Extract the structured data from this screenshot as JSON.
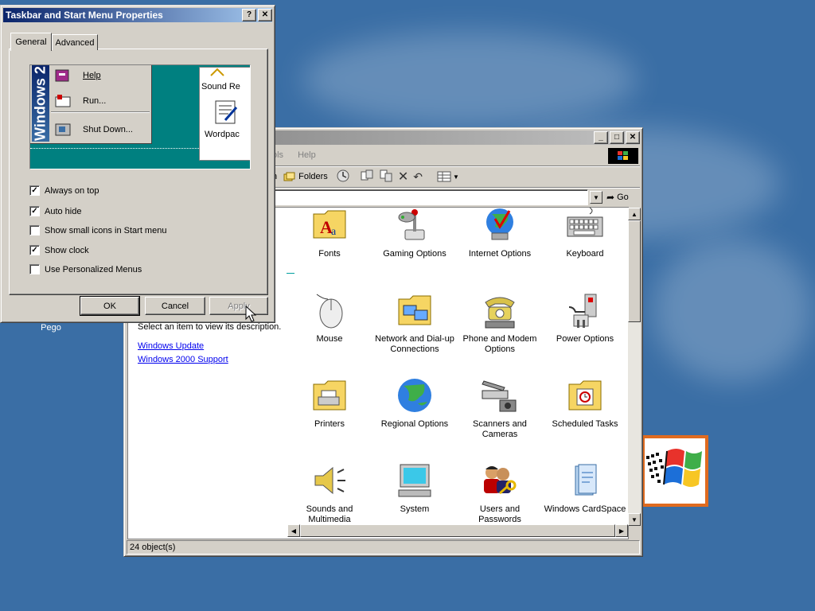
{
  "desktop": {
    "icon_label": "Pego"
  },
  "control_panel": {
    "menu_tools_partial": "ols",
    "menu_help": "Help",
    "toolbar_partial": "n",
    "toolbar_folders": "Folders",
    "go_label": "Go",
    "description_hint": "Select an item to view its description.",
    "links": [
      "Windows Update",
      "Windows 2000 Support"
    ],
    "items": [
      {
        "label": "Fonts",
        "icon": "fonts-icon"
      },
      {
        "label": "Gaming Options",
        "icon": "gamepad-icon"
      },
      {
        "label": "Internet Options",
        "icon": "globe-icon"
      },
      {
        "label": "Keyboard",
        "icon": "keyboard-icon"
      },
      {
        "label": "Mouse",
        "icon": "mouse-icon"
      },
      {
        "label": "Network and Dial-up Connections",
        "icon": "network-icon"
      },
      {
        "label": "Phone and Modem Options",
        "icon": "phone-icon"
      },
      {
        "label": "Power Options",
        "icon": "power-icon"
      },
      {
        "label": "Printers",
        "icon": "printer-icon"
      },
      {
        "label": "Regional Options",
        "icon": "globe-icon"
      },
      {
        "label": "Scanners and Cameras",
        "icon": "scanner-icon"
      },
      {
        "label": "Scheduled Tasks",
        "icon": "clock-folder-icon"
      },
      {
        "label": "Sounds and Multimedia",
        "icon": "speaker-icon"
      },
      {
        "label": "System",
        "icon": "computer-icon"
      },
      {
        "label": "Users and Passwords",
        "icon": "users-icon"
      },
      {
        "label": "Windows CardSpace",
        "icon": "cardspace-icon"
      }
    ],
    "status": "24 object(s)"
  },
  "dialog": {
    "title": "Taskbar and Start Menu Properties",
    "help_btn": "?",
    "close_btn": "✕",
    "tabs": [
      "General",
      "Advanced"
    ],
    "preview": {
      "brand": "Windows 2",
      "menu": [
        "Help",
        "Run...",
        "Shut Down..."
      ],
      "side_items": [
        "Sound Re",
        "Wordpac"
      ]
    },
    "options": [
      {
        "label": "Always on top",
        "checked": true
      },
      {
        "label": "Auto hide",
        "checked": true
      },
      {
        "label": "Show small icons in Start menu",
        "checked": false
      },
      {
        "label": "Show clock",
        "checked": true
      },
      {
        "label": "Use Personalized Menus",
        "checked": false
      }
    ],
    "buttons": {
      "ok": "OK",
      "cancel": "Cancel",
      "apply": "Apply"
    }
  }
}
